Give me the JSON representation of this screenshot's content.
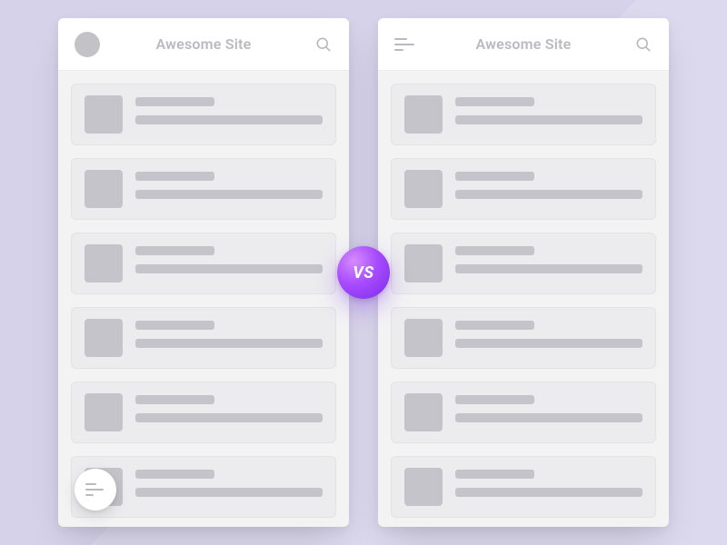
{
  "vs_label": "VS",
  "left": {
    "title": "Awesome Site",
    "header_variant": "avatar",
    "fab": true
  },
  "right": {
    "title": "Awesome Site",
    "header_variant": "menu",
    "fab": false
  },
  "card_count": 6,
  "colors": {
    "background": "#d6d2ea",
    "card": "#ececee",
    "skeleton": "#c4c4ca",
    "accent_gradient_from": "#d58bff",
    "accent_gradient_to": "#7a2be8"
  }
}
